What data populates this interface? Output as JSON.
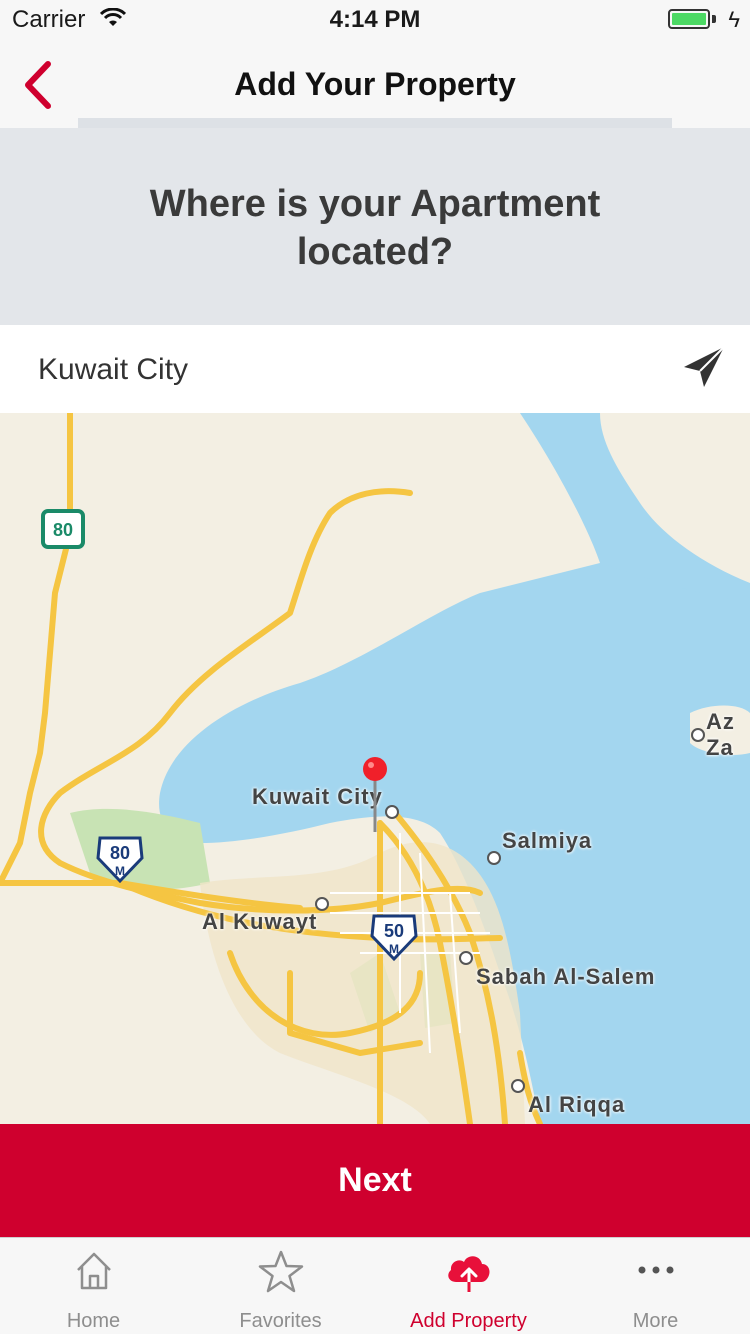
{
  "status_bar": {
    "carrier": "Carrier",
    "time": "4:14 PM",
    "battery_color": "#4cd964"
  },
  "nav": {
    "title": "Add Your Property",
    "back_icon": "chevron-left-icon",
    "accent": "#cf002e"
  },
  "question": "Where is your Apartment located?",
  "search": {
    "value": "Kuwait City",
    "locate_icon": "paper-plane-icon"
  },
  "map": {
    "labels": {
      "kuwait_city": "Kuwait City",
      "salmiya": "Salmiya",
      "al_kuwayt": "Al Kuwayt",
      "sabah_al_salem": "Sabah Al-Salem",
      "al_riqqa": "Al Riqqa",
      "az_zor": "Az Za"
    },
    "route_80_top": "80",
    "route_80_m": "80",
    "route_50_m": "50",
    "route_m_suffix": "M"
  },
  "next_button": "Next",
  "tabs": [
    {
      "label": "Home",
      "icon": "home-icon"
    },
    {
      "label": "Favorites",
      "icon": "star-icon"
    },
    {
      "label": "Add Property",
      "icon": "cloud-upload-icon",
      "active": true
    },
    {
      "label": "More",
      "icon": "more-dots-icon"
    }
  ]
}
